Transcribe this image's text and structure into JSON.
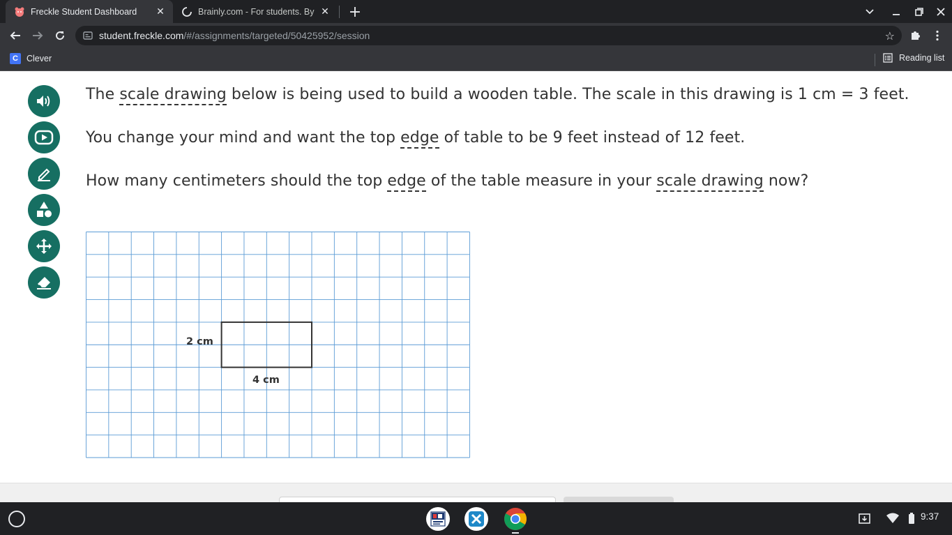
{
  "browser": {
    "tabs": [
      {
        "title": "Freckle Student Dashboard",
        "active": true
      },
      {
        "title": "Brainly.com - For students. By st",
        "active": false
      }
    ],
    "url_host": "student.freckle.com",
    "url_path": "/#/assignments/targeted/50425952/session",
    "bookmarks": [
      {
        "label": "Clever"
      }
    ],
    "reading_list": "Reading list"
  },
  "tools": [
    "speaker-icon",
    "play-video-icon",
    "pencil-icon",
    "shapes-icon",
    "move-icon",
    "eraser-icon"
  ],
  "question": {
    "line1": {
      "pre": "The ",
      "term": "scale drawing",
      "post": " below is being used to build a wooden table. The scale in this drawing is 1 cm = 3 feet."
    },
    "line2": {
      "pre": "You change your mind and want the top ",
      "term": "edge",
      "post": " of table to be 9 feet instead of 12 feet."
    },
    "line3": {
      "pre": "How many centimeters should the top ",
      "term1": "edge",
      "mid": " of the table measure in your ",
      "term2": "scale drawing",
      "post": " now?"
    }
  },
  "figure": {
    "grid_columns": 17,
    "grid_rows": 10,
    "rect_width_cm": 4,
    "rect_height_cm": 2,
    "height_label": "2 cm",
    "width_label": "4 cm"
  },
  "shelf": {
    "time": "9:37",
    "apps": [
      "nc-test-icon",
      "app-x-icon",
      "chrome-icon"
    ]
  },
  "colors": {
    "tool_bg": "#166f62",
    "grid_line": "#5b9bd5",
    "text": "#333333"
  }
}
